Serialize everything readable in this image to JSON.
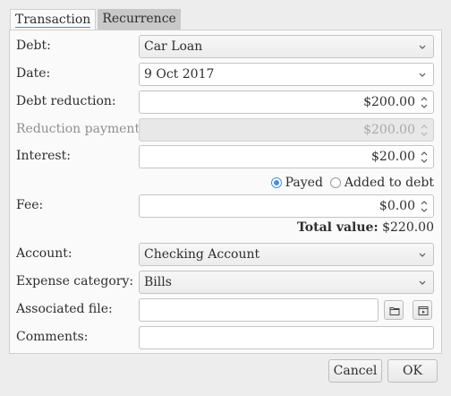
{
  "tabs": [
    {
      "label": "Transaction",
      "active": true
    },
    {
      "label": "Recurrence",
      "active": false
    }
  ],
  "form": {
    "debt": {
      "label": "Debt:",
      "value": "Car Loan"
    },
    "date": {
      "label": "Date:",
      "value": "9 Oct 2017"
    },
    "debt_reduction": {
      "label": "Debt reduction:",
      "value": "$200.00"
    },
    "reduction_payment": {
      "label": "Reduction payment:",
      "value": "$200.00",
      "disabled": true
    },
    "interest": {
      "label": "Interest:",
      "value": "$20.00"
    },
    "interest_options": {
      "payed": "Payed",
      "added": "Added to debt",
      "selected": "payed"
    },
    "fee": {
      "label": "Fee:",
      "value": "$0.00"
    },
    "total": {
      "label": "Total value:",
      "value": "$220.00"
    },
    "account": {
      "label": "Account:",
      "value": "Checking Account"
    },
    "expense_category": {
      "label": "Expense category:",
      "value": "Bills"
    },
    "associated_file": {
      "label": "Associated file:",
      "value": ""
    },
    "comments": {
      "label": "Comments:",
      "value": ""
    }
  },
  "buttons": {
    "cancel": "Cancel",
    "ok": "OK"
  },
  "colors": {
    "accent": "#4a90d9",
    "background": "#ededed",
    "panel": "#fafafa"
  }
}
